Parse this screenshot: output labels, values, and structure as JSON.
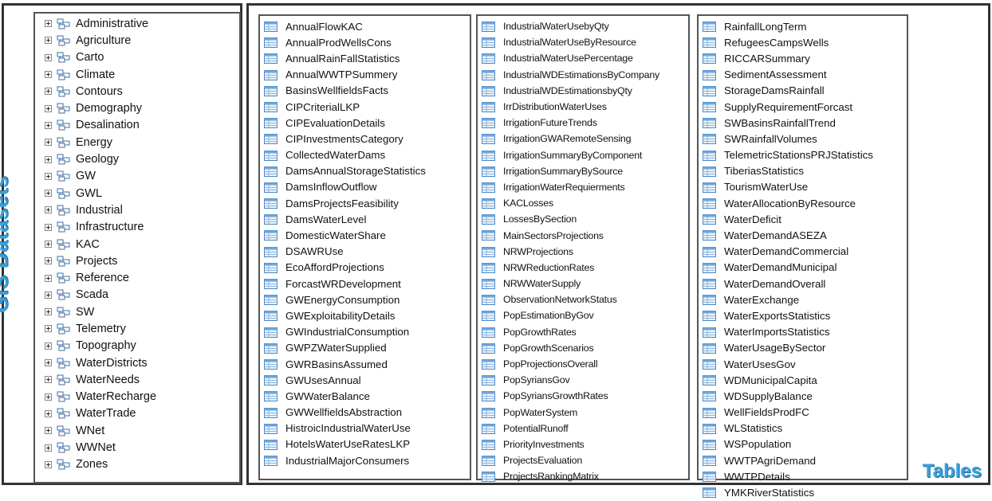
{
  "left_title": "GIS Datasets",
  "right_title": "Tables",
  "datasets": [
    "Administrative",
    "Agriculture",
    "Carto",
    "Climate",
    "Contours",
    "Demography",
    "Desalination",
    "Energy",
    "Geology",
    "GW",
    "GWL",
    "Industrial",
    "Infrastructure",
    "KAC",
    "Projects",
    "Reference",
    "Scada",
    "SW",
    "Telemetry",
    "Topography",
    "WaterDistricts",
    "WaterNeeds",
    "WaterRecharge",
    "WaterTrade",
    "WNet",
    "WWNet",
    "Zones"
  ],
  "tables_col1": [
    "AnnualFlowKAC",
    "AnnualProdWellsCons",
    "AnnualRainFallStatistics",
    "AnnualWWTPSummery",
    "BasinsWellfieldsFacts",
    "CIPCriterialLKP",
    "CIPEvaluationDetails",
    "CIPInvestmentsCategory",
    "CollectedWaterDams",
    "DamsAnnualStorageStatistics",
    "DamsInflowOutflow",
    "DamsProjectsFeasibility",
    "DamsWaterLevel",
    "DomesticWaterShare",
    "DSAWRUse",
    "EcoAffordProjections",
    "ForcastWRDevelopment",
    "GWEnergyConsumption",
    "GWExploitabilityDetails",
    "GWIndustrialConsumption",
    "GWPZWaterSupplied",
    "GWRBasinsAssumed",
    "GWUsesAnnual",
    "GWWaterBalance",
    "GWWellfieldsAbstraction",
    "HistroicIndustrialWaterUse",
    "HotelsWaterUseRatesLKP",
    "IndustrialMajorConsumers"
  ],
  "tables_col2": [
    "IndustrialWaterUsebyQty",
    "IndustrialWaterUseByResource",
    "IndustrialWaterUsePercentage",
    "IndustrialWDEstimationsByCompany",
    "IndustrialWDEstimationsbyQty",
    "IrrDistributionWaterUses",
    "IrrigationFutureTrends",
    "IrrigationGWARemoteSensing",
    "IrrigationSummaryByComponent",
    "IrrigationSummaryBySource",
    "IrrigationWaterRequierments",
    "KACLosses",
    "LossesBySection",
    "MainSectorsProjections",
    "NRWProjections",
    "NRWReductionRates",
    "NRWWaterSupply",
    "ObservationNetworkStatus",
    "PopEstimationByGov",
    "PopGrowthRates",
    "PopGrowthScenarios",
    "PopProjectionsOverall",
    "PopSyriansGov",
    "PopSyriansGrowthRates",
    "PopWaterSystem",
    "PotentialRunoff",
    "PriorityInvestments",
    "ProjectsEvaluation",
    "ProjectsRankingMatrix"
  ],
  "tables_col3": [
    "RainfallLongTerm",
    "RefugeesCampsWells",
    "RICCARSummary",
    "SedimentAssessment",
    "StorageDamsRainfall",
    "SupplyRequirementForcast",
    "SWBasinsRainfallTrend",
    "SWRainfallVolumes",
    "TelemetricStationsPRJStatistics",
    "TiberiasStatistics",
    "TourismWaterUse",
    "WaterAllocationByResource",
    "WaterDeficit",
    "WaterDemandASEZA",
    "WaterDemandCommercial",
    "WaterDemandMunicipal",
    "WaterDemandOverall",
    "WaterExchange",
    "WaterExportsStatistics",
    "WaterImportsStatistics",
    "WaterUsageBySector",
    "WaterUsesGov",
    "WDMunicipalCapita",
    "WDSupplyBalance",
    "WellFieldsProdFC",
    "WLStatistics",
    "WSPopulation",
    "WWTPAgriDemand",
    "WWTPDetails",
    "YMKRiverStatistics"
  ],
  "colors": {
    "accent": "#3a9fd8",
    "border": "#555555"
  },
  "icons": {
    "dataset": "feature-dataset-icon",
    "table": "table-icon",
    "expander": "plus-expander-icon"
  }
}
